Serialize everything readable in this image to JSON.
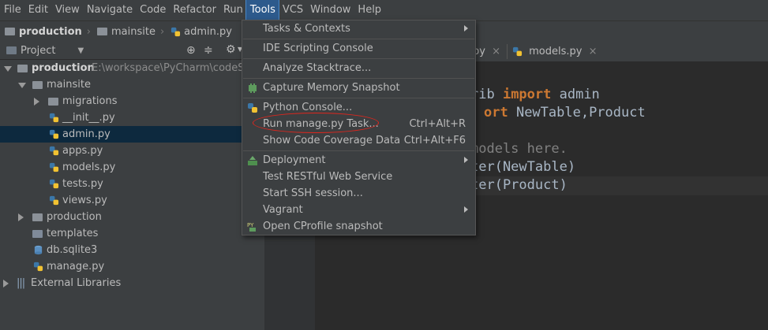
{
  "menubar": {
    "items": [
      "File",
      "Edit",
      "View",
      "Navigate",
      "Code",
      "Refactor",
      "Run",
      "Tools",
      "VCS",
      "Window",
      "Help"
    ],
    "active": "Tools"
  },
  "breadcrumb": {
    "project": "production",
    "folder": "mainsite",
    "file": "admin.py"
  },
  "project_panel": {
    "title": "Project",
    "icons": [
      "target-icon",
      "collapse-icon",
      "gear-icon"
    ]
  },
  "tree": {
    "root_name": "production",
    "root_path": "E:\\workspace\\PyCharm\\codeSpac",
    "items": {
      "mainsite": "mainsite",
      "migrations": "migrations",
      "init": "__init__.py",
      "admin": "admin.py",
      "apps": "apps.py",
      "models": "models.py",
      "tests": "tests.py",
      "views": "views.py",
      "production": "production",
      "templates": "templates",
      "db": "db.sqlite3",
      "manage": "manage.py",
      "external": "External Libraries"
    }
  },
  "tabs": {
    "tab1": "py",
    "tab2": "models.py"
  },
  "editor": {
    "line1_a": "rib ",
    "line1_kw": "import",
    "line1_b": " admin",
    "line2_kw": "ort",
    "line2_b": " NewTable,Product",
    "line3": "models here.",
    "line4": "ter(NewTable)",
    "line5": "ter(Product)"
  },
  "tools_menu": {
    "tasks": "Tasks & Contexts",
    "ide_console": "IDE Scripting Console",
    "stacktrace": "Analyze Stacktrace...",
    "memory": "Capture Memory Snapshot",
    "python_console": "Python Console...",
    "manage_task": "Run manage.py Task...",
    "manage_task_shortcut": "Ctrl+Alt+R",
    "coverage": "Show Code Coverage Data",
    "coverage_shortcut": "Ctrl+Alt+F6",
    "deployment": "Deployment",
    "rest": "Test RESTful Web Service",
    "ssh": "Start SSH session...",
    "vagrant": "Vagrant",
    "cprofile": "Open CProfile snapshot"
  },
  "colors": {
    "accent": "#2d5a8c",
    "highlight_circle": "#e0261d",
    "keyword": "#cc7832"
  }
}
